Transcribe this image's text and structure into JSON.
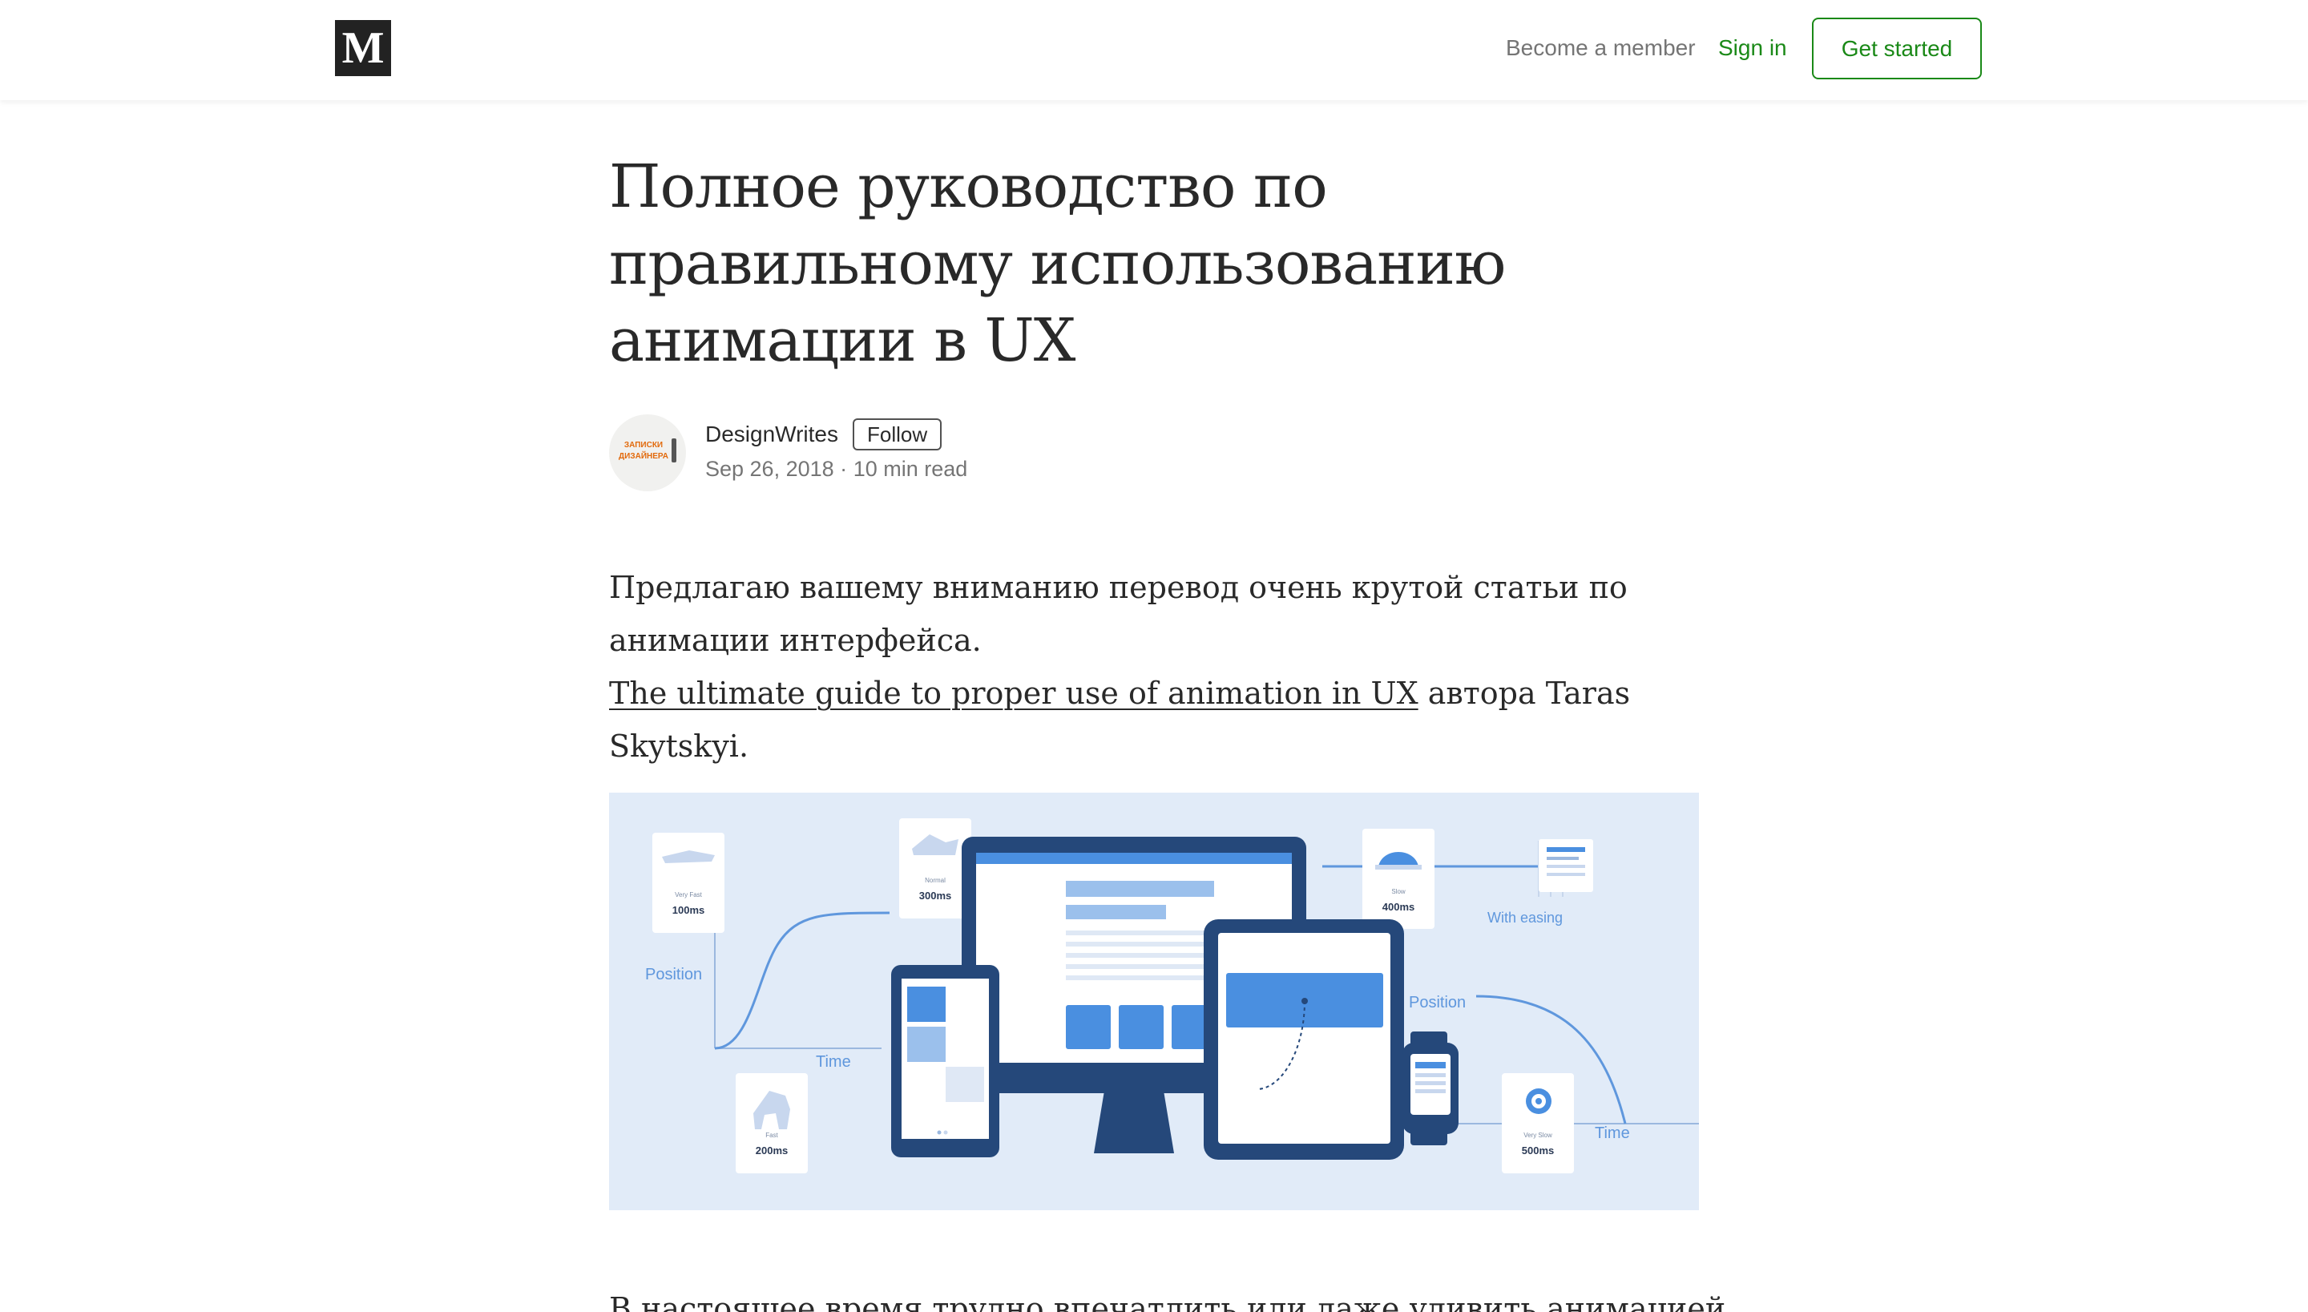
{
  "header": {
    "logo_letter": "M",
    "become_member": "Become a member",
    "sign_in": "Sign in",
    "get_started": "Get started",
    "accent_color": "#1a8917"
  },
  "article": {
    "title": "Полное руководство по правильному использованию анимации в UX",
    "author": {
      "name": "DesignWrites",
      "avatar_text": "ЗАПИСКИ ДИЗАЙНЕРА",
      "follow_label": "Follow",
      "date": "Sep 26, 2018",
      "separator": "·",
      "read_time": "10 min read"
    },
    "intro": {
      "line1": "Предлагаю вашему вниманию перевод очень крутой статьи по анимации интерфейса.",
      "link_text": "The ultimate guide to proper use of animation in UX",
      "link_suffix": " автора Taras Skytskyi."
    },
    "hero": {
      "labels": {
        "position_left": "Position",
        "time_left": "Time",
        "with_easing": "With easing",
        "position_right": "Position",
        "time_right": "Time"
      },
      "cards": [
        {
          "speed": "Very Fast",
          "ms": "100ms"
        },
        {
          "speed": "Normal",
          "ms": "300ms"
        },
        {
          "speed": "Fast",
          "ms": "200ms"
        },
        {
          "speed": "Slow",
          "ms": "400ms"
        },
        {
          "speed": "Very Slow",
          "ms": "500ms"
        }
      ]
    },
    "paragraph2": "В настоящее время трудно впечатлить или даже удивить анимацией"
  }
}
